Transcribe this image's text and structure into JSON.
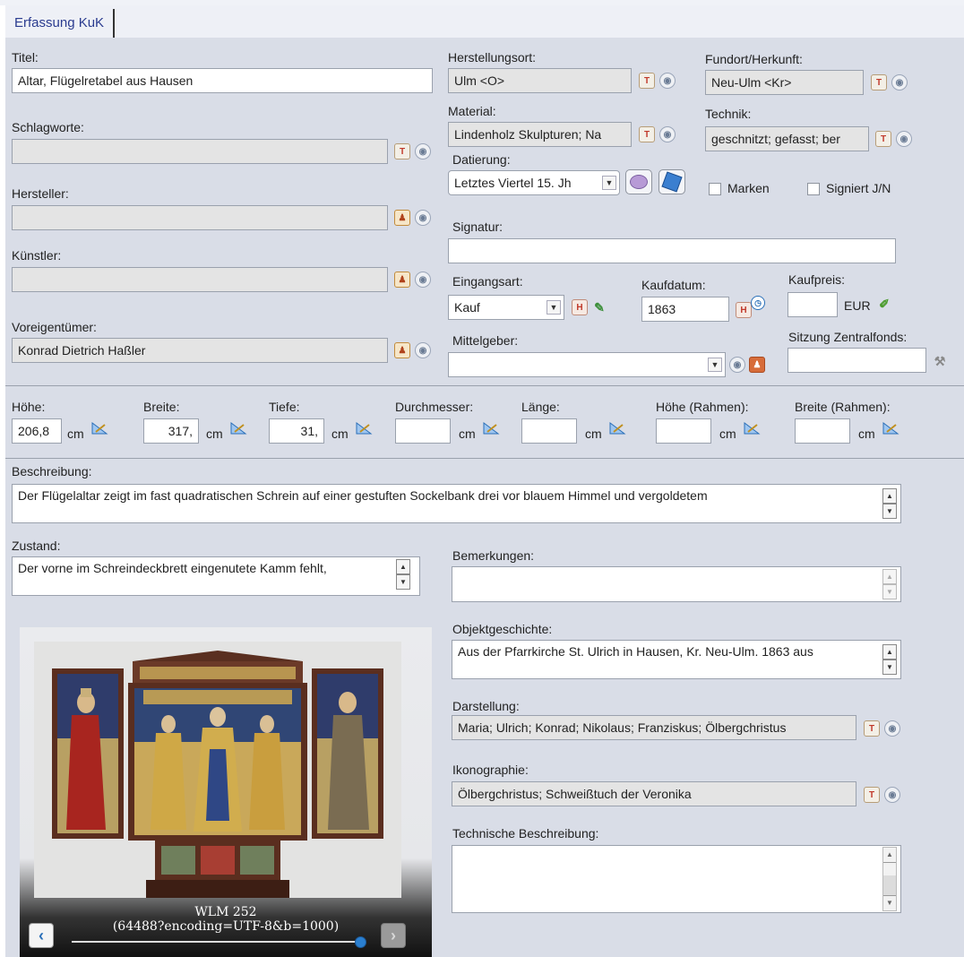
{
  "tab": {
    "label": "Erfassung KuK"
  },
  "titel": {
    "label": "Titel:",
    "value": "Altar, Flügelretabel aus Hausen"
  },
  "schlagworte": {
    "label": "Schlagworte:",
    "value": ""
  },
  "hersteller": {
    "label": "Hersteller:",
    "value": ""
  },
  "kuenstler": {
    "label": "Künstler:",
    "value": ""
  },
  "voreigentuemer": {
    "label": "Voreigentümer:",
    "value": "Konrad Dietrich Haßler"
  },
  "herstellungsort": {
    "label": "Herstellungsort:",
    "value": "Ulm <O>"
  },
  "fundort": {
    "label": "Fundort/Herkunft:",
    "value": "Neu-Ulm <Kr>"
  },
  "material": {
    "label": "Material:",
    "value": "Lindenholz Skulpturen; Na"
  },
  "technik": {
    "label": "Technik:",
    "value": "geschnitzt; gefasst; ber"
  },
  "datierung": {
    "label": "Datierung:",
    "value": "Letztes Viertel 15. Jh"
  },
  "marken": {
    "label": "Marken"
  },
  "signiert": {
    "label": "Signiert J/N"
  },
  "signatur": {
    "label": "Signatur:",
    "value": ""
  },
  "eingangsart": {
    "label": "Eingangsart:",
    "value": "Kauf"
  },
  "kaufdatum": {
    "label": "Kaufdatum:",
    "value": "1863"
  },
  "kaufpreis": {
    "label": "Kaufpreis:",
    "value": "",
    "currency": "EUR"
  },
  "mittelgeber": {
    "label": "Mittelgeber:",
    "value": ""
  },
  "sitzung": {
    "label": "Sitzung Zentralfonds:",
    "value": ""
  },
  "masse": {
    "unit": "cm",
    "hoehe": {
      "label": "Höhe:",
      "value": "206,8"
    },
    "breite": {
      "label": "Breite:",
      "value": "317,"
    },
    "tiefe": {
      "label": "Tiefe:",
      "value": "31,"
    },
    "durchmesser": {
      "label": "Durchmesser:",
      "value": ""
    },
    "laenge": {
      "label": "Länge:",
      "value": ""
    },
    "hoehe_rahmen": {
      "label": "Höhe (Rahmen):",
      "value": ""
    },
    "breite_rahmen": {
      "label": "Breite (Rahmen):",
      "value": ""
    }
  },
  "beschreibung": {
    "label": "Beschreibung:",
    "value": "Der Flügelaltar zeigt im fast quadratischen Schrein auf einer gestuften Sockelbank drei vor blauem Himmel und vergoldetem"
  },
  "zustand": {
    "label": "Zustand:",
    "value": "Der vorne im Schreindeckbrett eingenutete Kamm fehlt,"
  },
  "bemerkungen": {
    "label": "Bemerkungen:",
    "value": ""
  },
  "objektgeschichte": {
    "label": "Objektgeschichte:",
    "value": "Aus der Pfarrkirche St. Ulrich in Hausen, Kr. Neu-Ulm. 1863 aus"
  },
  "darstellung": {
    "label": "Darstellung:",
    "value": "Maria; Ulrich; Konrad; Nikolaus; Franziskus; Ölbergchristus"
  },
  "ikonographie": {
    "label": "Ikonographie:",
    "value": "Ölbergchristus; Schweißtuch der Veronika"
  },
  "technische_beschreibung": {
    "label": "Technische Beschreibung:",
    "value": ""
  },
  "image": {
    "caption_line1": "WLM 252",
    "caption_line2": "(64488?encoding=UTF-8&b=1000)"
  }
}
